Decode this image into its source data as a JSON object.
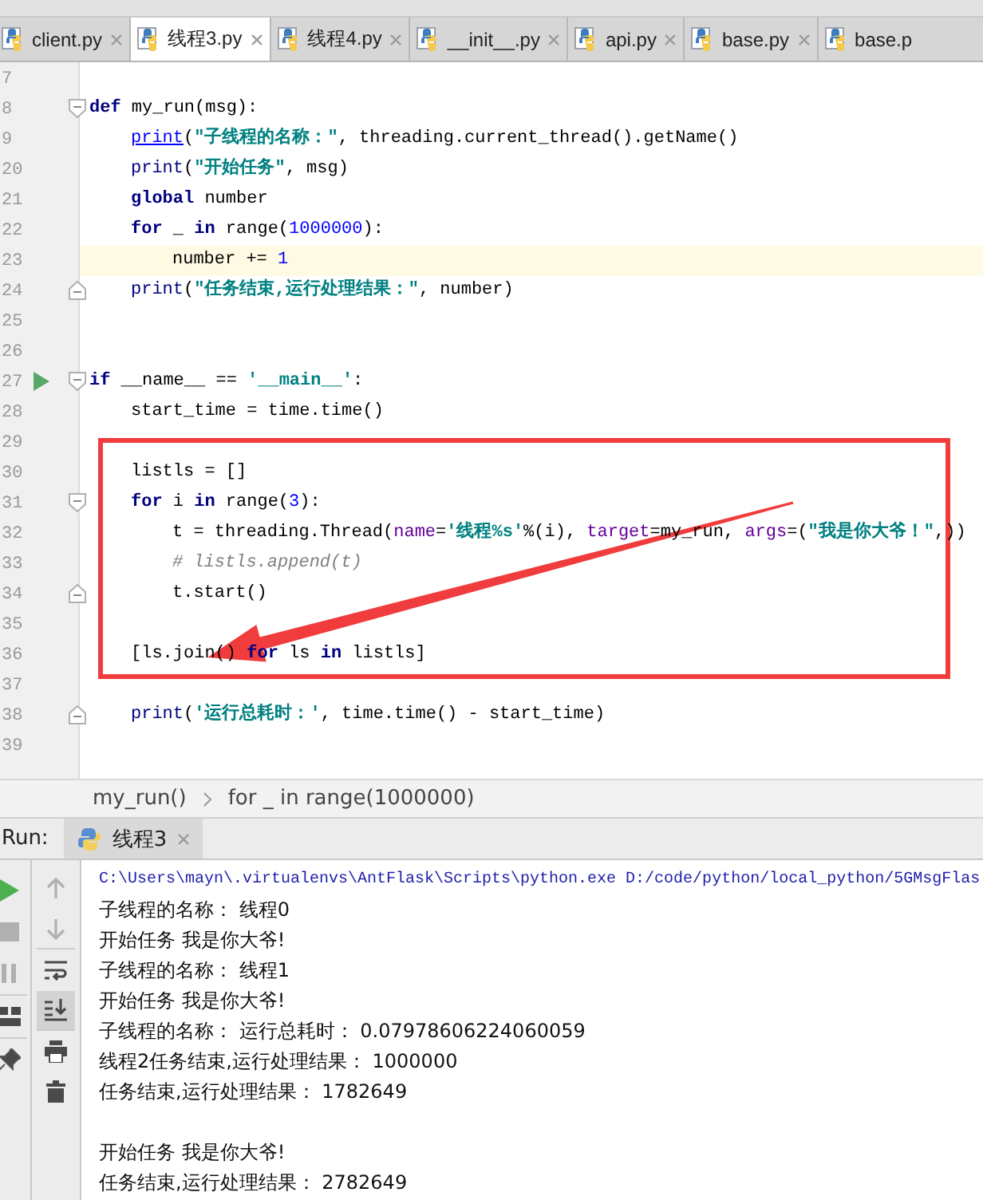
{
  "tabs": [
    {
      "label": "client.py",
      "selected": false
    },
    {
      "label": "线程3.py",
      "selected": true
    },
    {
      "label": "线程4.py",
      "selected": false
    },
    {
      "label": "__init__.py",
      "selected": false
    },
    {
      "label": "api.py",
      "selected": false
    },
    {
      "label": "base.py",
      "selected": false
    },
    {
      "label": "base.p",
      "selected": false
    }
  ],
  "editor": {
    "lines": [
      {
        "number": "7",
        "current": false
      },
      {
        "number": "8",
        "current": false,
        "tokens": [
          {
            "kind": "keyword",
            "text": "def"
          },
          {
            "kind": "plain",
            "text": " my_run(msg):"
          }
        ],
        "children": [
          {
            "number": "9",
            "current": false,
            "tokens": [
              {
                "kind": "link",
                "text": "print"
              },
              {
                "kind": "plain",
                "text": "("
              },
              {
                "kind": "string",
                "text": "\"子线程的名称：\""
              },
              {
                "kind": "plain",
                "text": ", threading.current_thread().getName()"
              }
            ]
          },
          {
            "number": "20",
            "current": false,
            "tokens": [
              {
                "kind": "builtin",
                "text": "print"
              },
              {
                "kind": "plain",
                "text": "("
              },
              {
                "kind": "string",
                "text": "\"开始任务\""
              },
              {
                "kind": "plain",
                "text": ", msg)"
              }
            ]
          },
          {
            "number": "21",
            "current": false,
            "tokens": [
              {
                "kind": "keyword",
                "text": "global"
              },
              {
                "kind": "plain",
                "text": " number"
              }
            ]
          },
          {
            "number": "22",
            "current": false,
            "tokens": [
              {
                "kind": "keyword",
                "text": "for"
              },
              {
                "kind": "plain",
                "text": " _ "
              },
              {
                "kind": "keyword",
                "text": "in"
              },
              {
                "kind": "plain",
                "text": " range("
              },
              {
                "kind": "number",
                "text": "1000000"
              },
              {
                "kind": "plain",
                "text": "):"
              }
            ],
            "children": [
              {
                "number": "23",
                "current": true,
                "tokens": [
                  {
                    "kind": "plain",
                    "text": "number += "
                  },
                  {
                    "kind": "number",
                    "text": "1"
                  }
                ]
              }
            ]
          },
          {
            "number": "24",
            "current": false,
            "tokens": [
              {
                "kind": "builtin",
                "text": "print"
              },
              {
                "kind": "plain",
                "text": "("
              },
              {
                "kind": "string",
                "text": "\"任务结束,运行处理结果：\""
              },
              {
                "kind": "plain",
                "text": ", number)"
              }
            ]
          }
        ]
      },
      {
        "number": "25",
        "current": false
      },
      {
        "number": "26",
        "current": false
      },
      {
        "number": "27",
        "current": false,
        "run": true,
        "tokens": [
          {
            "kind": "keyword",
            "text": "if"
          },
          {
            "kind": "plain",
            "text": " __name__ == "
          },
          {
            "kind": "string",
            "text": "'__main__'"
          },
          {
            "kind": "plain",
            "text": ":"
          }
        ],
        "children": [
          {
            "number": "28",
            "current": false,
            "tokens": [
              {
                "kind": "plain",
                "text": "start_time = time.time()"
              }
            ]
          },
          {
            "number": "29",
            "current": false
          },
          {
            "number": "30",
            "current": false,
            "tokens": [
              {
                "kind": "plain",
                "text": "listls = []"
              }
            ]
          },
          {
            "number": "31",
            "current": false,
            "tokens": [
              {
                "kind": "keyword",
                "text": "for"
              },
              {
                "kind": "plain",
                "text": " i "
              },
              {
                "kind": "keyword",
                "text": "in"
              },
              {
                "kind": "plain",
                "text": " range("
              },
              {
                "kind": "number",
                "text": "3"
              },
              {
                "kind": "plain",
                "text": "):"
              }
            ],
            "children": [
              {
                "number": "32",
                "current": false,
                "tokens": [
                  {
                    "kind": "plain",
                    "text": "t = threading.Thread("
                  },
                  {
                    "kind": "kwarg",
                    "text": "name"
                  },
                  {
                    "kind": "plain",
                    "text": "="
                  },
                  {
                    "kind": "string",
                    "text": "'线程%s'"
                  },
                  {
                    "kind": "plain",
                    "text": "%(i), "
                  },
                  {
                    "kind": "kwarg",
                    "text": "target"
                  },
                  {
                    "kind": "plain",
                    "text": "=my_run, "
                  },
                  {
                    "kind": "kwarg",
                    "text": "args"
                  },
                  {
                    "kind": "plain",
                    "text": "=("
                  },
                  {
                    "kind": "string",
                    "text": "\"我是你大爷！\""
                  },
                  {
                    "kind": "plain",
                    "text": ",))"
                  }
                ]
              },
              {
                "number": "33",
                "current": false,
                "tokens": [
                  {
                    "kind": "comment",
                    "text": "# listls.append(t)"
                  }
                ]
              },
              {
                "number": "34",
                "current": false,
                "tokens": [
                  {
                    "kind": "plain",
                    "text": "t.start()"
                  }
                ]
              }
            ]
          },
          {
            "number": "35",
            "current": false
          },
          {
            "number": "36",
            "current": false,
            "tokens": [
              {
                "kind": "plain",
                "text": "[ls.join() "
              },
              {
                "kind": "keyword",
                "text": "for"
              },
              {
                "kind": "plain",
                "text": " ls "
              },
              {
                "kind": "keyword",
                "text": "in"
              },
              {
                "kind": "plain",
                "text": " listls]"
              }
            ]
          },
          {
            "number": "37",
            "current": false
          },
          {
            "number": "38",
            "current": false,
            "tokens": [
              {
                "kind": "builtin",
                "text": "print"
              },
              {
                "kind": "plain",
                "text": "("
              },
              {
                "kind": "string",
                "text": "'运行总耗时：'"
              },
              {
                "kind": "plain",
                "text": ", time.time() - start_time)"
              }
            ]
          }
        ]
      },
      {
        "number": "39",
        "current": false
      }
    ]
  },
  "breadcrumb": [
    "my_run()",
    "for _ in range(1000000)"
  ],
  "run_panel": {
    "label": "Run:",
    "tab": {
      "label": "线程3",
      "selected": true
    },
    "tools_left": [
      {
        "kind": "run",
        "disabled": false
      },
      {
        "kind": "stop",
        "disabled": true
      },
      {
        "kind": "pause",
        "disabled": true
      },
      {
        "kind": "layout",
        "disabled": false
      },
      {
        "kind": "pin",
        "disabled": false
      }
    ],
    "tools_right": [
      {
        "kind": "up",
        "disabled": true,
        "on": false
      },
      {
        "kind": "down",
        "disabled": true,
        "on": false
      },
      {
        "kind": "wrap",
        "disabled": false,
        "on": false
      },
      {
        "kind": "scroll_end",
        "disabled": false,
        "on": true
      },
      {
        "kind": "print",
        "disabled": false,
        "on": false
      },
      {
        "kind": "trash",
        "disabled": false,
        "on": false
      }
    ],
    "console": [
      {
        "kind": "command",
        "text": "C:\\Users\\mayn\\.virtualenvs\\AntFlask\\Scripts\\python.exe D:/code/python/local_python/5GMsgFlas"
      },
      {
        "kind": "output",
        "text": "子线程的名称： 线程0"
      },
      {
        "kind": "output",
        "text": "开始任务 我是你大爷!"
      },
      {
        "kind": "output",
        "text": "子线程的名称： 线程1"
      },
      {
        "kind": "output",
        "text": "开始任务 我是你大爷!"
      },
      {
        "kind": "output",
        "text": "子线程的名称： 运行总耗时： 0.07978606224060059"
      },
      {
        "kind": "output",
        "text": "线程2任务结束,运行处理结果： 1000000"
      },
      {
        "kind": "output",
        "text": "任务结束,运行处理结果： 1782649"
      },
      {
        "kind": "output",
        "text": "开始任务 我是你大爷!",
        "gap_before": true
      },
      {
        "kind": "output",
        "text": "任务结束,运行处理结果： 2782649"
      }
    ]
  }
}
